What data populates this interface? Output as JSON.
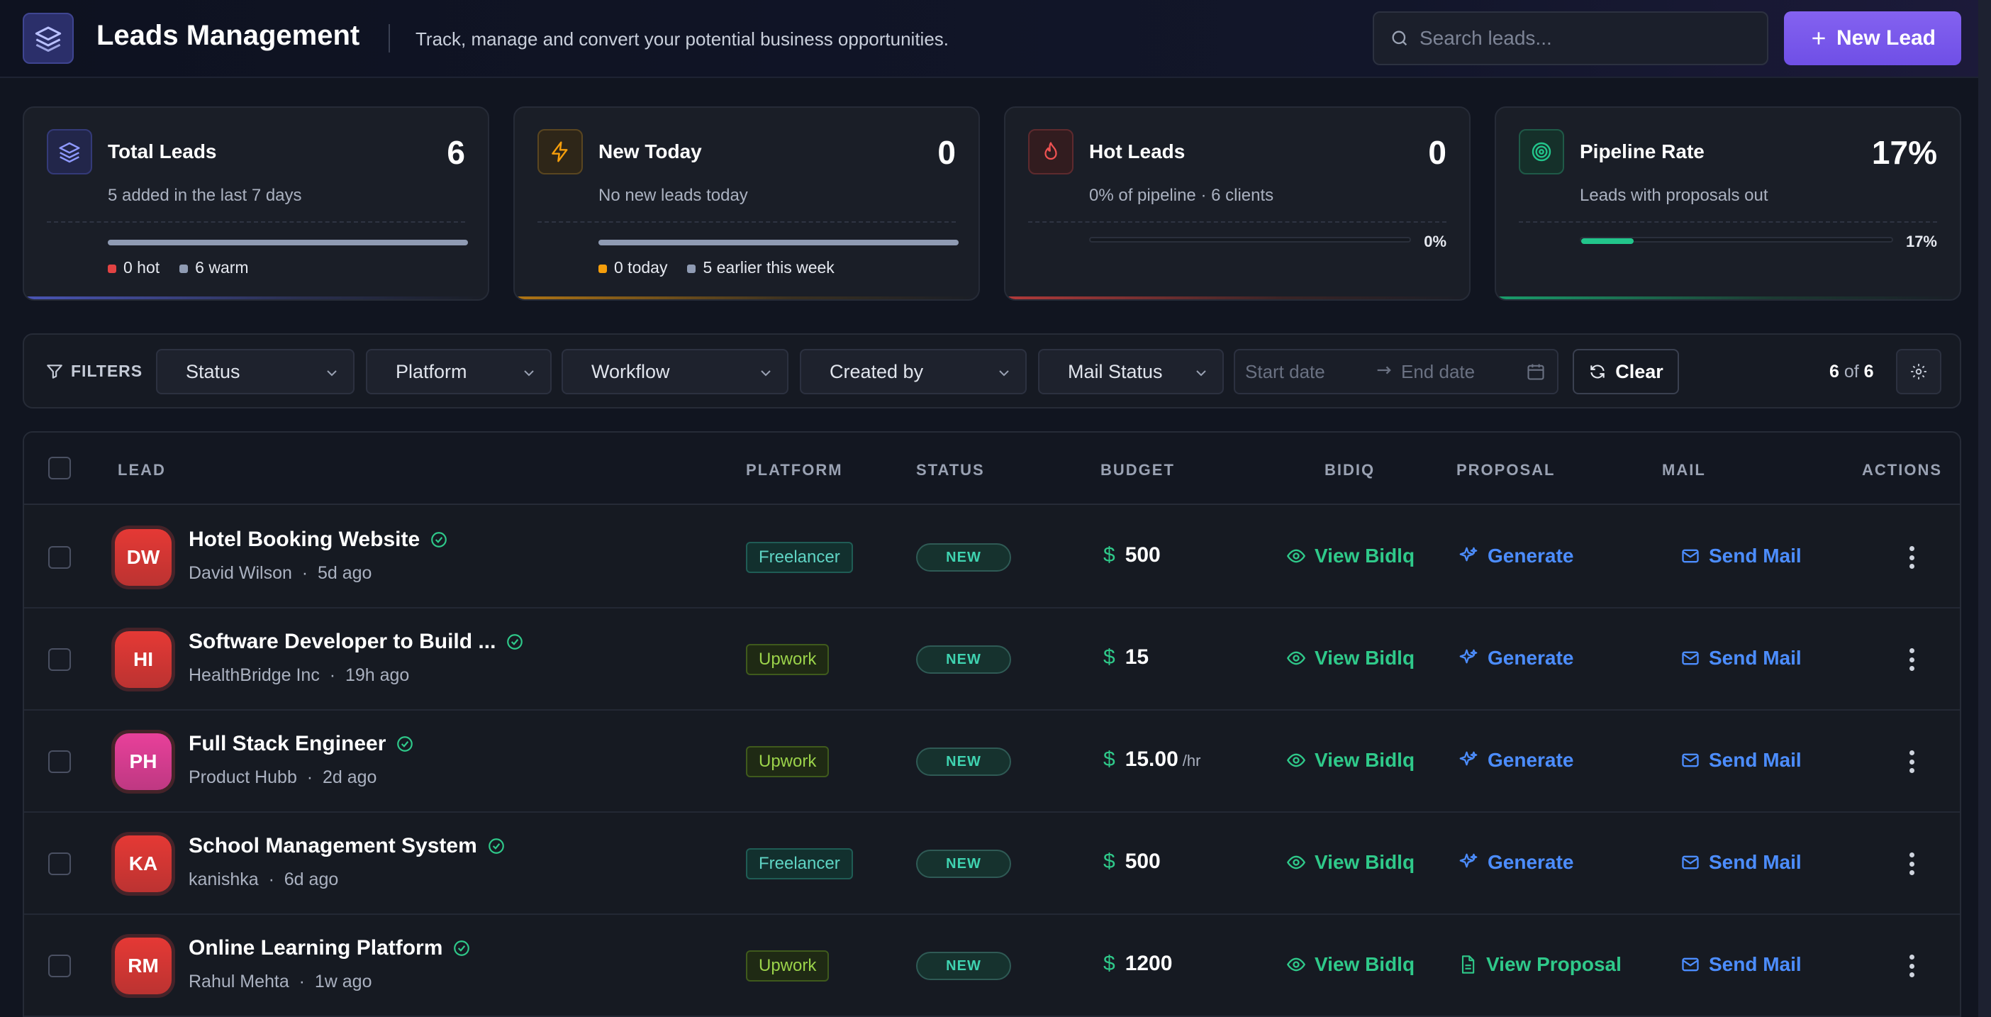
{
  "header": {
    "title": "Leads Management",
    "subtitle": "Track, manage and convert your potential business opportunities.",
    "search_placeholder": "Search leads...",
    "new_lead_label": "New Lead"
  },
  "stats": [
    {
      "label": "Total Leads",
      "value": "6",
      "desc": "5 added in the last 7 days",
      "fill": 1.0,
      "fill_color": "#8f9bb3",
      "accent": "#4a55b5",
      "legend": [
        {
          "dot": "#e24343",
          "text": "0 hot"
        },
        {
          "dot": "#8f9bb3",
          "text": "6 warm"
        }
      ]
    },
    {
      "label": "New Today",
      "value": "0",
      "desc": "No new leads today",
      "fill": 1.0,
      "fill_color": "#8f9bb3",
      "accent": "#b07514",
      "legend": [
        {
          "dot": "#f59e0b",
          "text": "0 today"
        },
        {
          "dot": "#8f9bb3",
          "text": "5 earlier this week"
        }
      ]
    },
    {
      "label": "Hot Leads",
      "value": "0",
      "desc": "0% of pipeline · 6 clients",
      "fill": 0.0,
      "fill_color": "#e24343",
      "accent": "#b23a3a",
      "pct": "0%"
    },
    {
      "label": "Pipeline Rate",
      "value": "17%",
      "desc": "Leads with proposals out",
      "fill": 0.17,
      "fill_color": "#22c58b",
      "accent": "#1a9e6c",
      "pct": "17%"
    }
  ],
  "filters": {
    "label": "FILTERS",
    "selects": [
      "Status",
      "Platform",
      "Workflow",
      "Created by",
      "Mail Status"
    ],
    "start_date_placeholder": "Start date",
    "end_date_placeholder": "End date",
    "clear_label": "Clear",
    "count_shown": "6",
    "count_of": "of",
    "count_total": "6"
  },
  "table": {
    "headers": [
      "LEAD",
      "PLATFORM",
      "STATUS",
      "BUDGET",
      "BIDIQ",
      "PROPOSAL",
      "MAIL",
      "ACTIONS"
    ],
    "rows": [
      {
        "initials": "DW",
        "avatar_color": "#e53935",
        "title": "Hotel Booking Website",
        "client": "David Wilson",
        "age": "5d ago",
        "platform": "Freelancer",
        "status": "NEW",
        "currency": "$",
        "budget": "500",
        "unit": "",
        "bidiq": "View Bidlq",
        "proposal": "Generate",
        "proposal_type": "generate",
        "mail": "Send Mail"
      },
      {
        "initials": "HI",
        "avatar_color": "#e53935",
        "title": "Software Developer to Build ...",
        "client": "HealthBridge Inc",
        "age": "19h ago",
        "platform": "Upwork",
        "status": "NEW",
        "currency": "$",
        "budget": "15",
        "unit": "",
        "bidiq": "View Bidlq",
        "proposal": "Generate",
        "proposal_type": "generate",
        "mail": "Send Mail"
      },
      {
        "initials": "PH",
        "avatar_color": "#e8409a",
        "title": "Full Stack Engineer",
        "client": "Product Hubb",
        "age": "2d ago",
        "platform": "Upwork",
        "status": "NEW",
        "currency": "$",
        "budget": "15.00",
        "unit": "/hr",
        "bidiq": "View Bidlq",
        "proposal": "Generate",
        "proposal_type": "generate",
        "mail": "Send Mail"
      },
      {
        "initials": "KA",
        "avatar_color": "#e53935",
        "title": "School Management System",
        "client": "kanishka",
        "age": "6d ago",
        "platform": "Freelancer",
        "status": "NEW",
        "currency": "$",
        "budget": "500",
        "unit": "",
        "bidiq": "View Bidlq",
        "proposal": "Generate",
        "proposal_type": "generate",
        "mail": "Send Mail"
      },
      {
        "initials": "RM",
        "avatar_color": "#e53935",
        "title": "Online Learning Platform",
        "client": "Rahul Mehta",
        "age": "1w ago",
        "platform": "Upwork",
        "status": "NEW",
        "currency": "$",
        "budget": "1200",
        "unit": "",
        "bidiq": "View Bidlq",
        "proposal": "View Proposal",
        "proposal_type": "view",
        "mail": "Send Mail"
      }
    ]
  },
  "colors": {
    "accent": "#7c5cf0",
    "green": "#2fc98a",
    "blue": "#4c8dff"
  }
}
